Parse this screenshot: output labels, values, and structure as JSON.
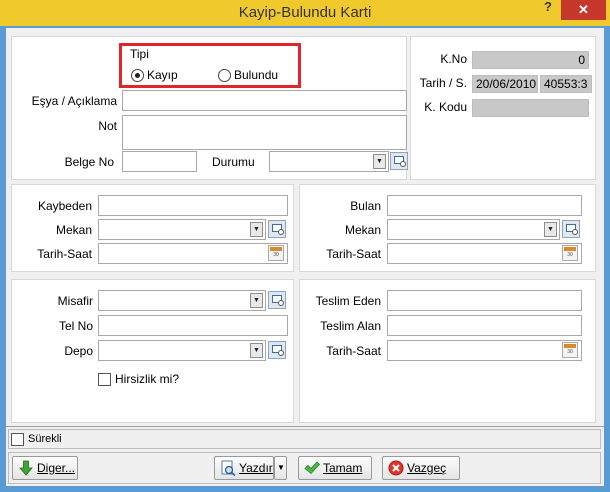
{
  "window": {
    "title": "Kayip-Bulundu Karti",
    "help": "?",
    "close": "✕"
  },
  "tipi": {
    "legend": "Tipi",
    "options": [
      "Kayıp",
      "Bulundu"
    ],
    "selected": "Kayıp"
  },
  "top": {
    "esya_label": "Eşya / Açıklama",
    "esya_value": "",
    "not_label": "Not",
    "not_value": "",
    "belge_label": "Belge No",
    "belge_value": "",
    "durumu_label": "Durumu",
    "durumu_value": ""
  },
  "info": {
    "kno_label": "K.No",
    "kno_value": "0",
    "tarih_label": "Tarih / S.",
    "tarih_value": "20/06/2010",
    "saat_value": "40553:3",
    "kkodu_label": "K. Kodu",
    "kkodu_value": ""
  },
  "kaybeden": {
    "kaybeden_label": "Kaybeden",
    "mekan_label": "Mekan",
    "tarihsaat_label": "Tarih-Saat"
  },
  "bulan": {
    "bulan_label": "Bulan",
    "mekan_label": "Mekan",
    "tarihsaat_label": "Tarih-Saat"
  },
  "misafir": {
    "misafir_label": "Misafir",
    "telno_label": "Tel No",
    "depo_label": "Depo",
    "hirsizlik_label": "Hirsizlik mi?"
  },
  "teslim": {
    "eden_label": "Teslim Eden",
    "alan_label": "Teslim Alan",
    "tarihsaat_label": "Tarih-Saat"
  },
  "surekli_label": "Sürekli",
  "buttons": {
    "diger": "Diger...",
    "yazdir": "Yazdır",
    "tamam": "Tamam",
    "vazgec": "Vazgeç"
  },
  "colors": {
    "titlebar": "#f0c92c",
    "highlight": "#e0262c",
    "close": "#c7382c"
  }
}
